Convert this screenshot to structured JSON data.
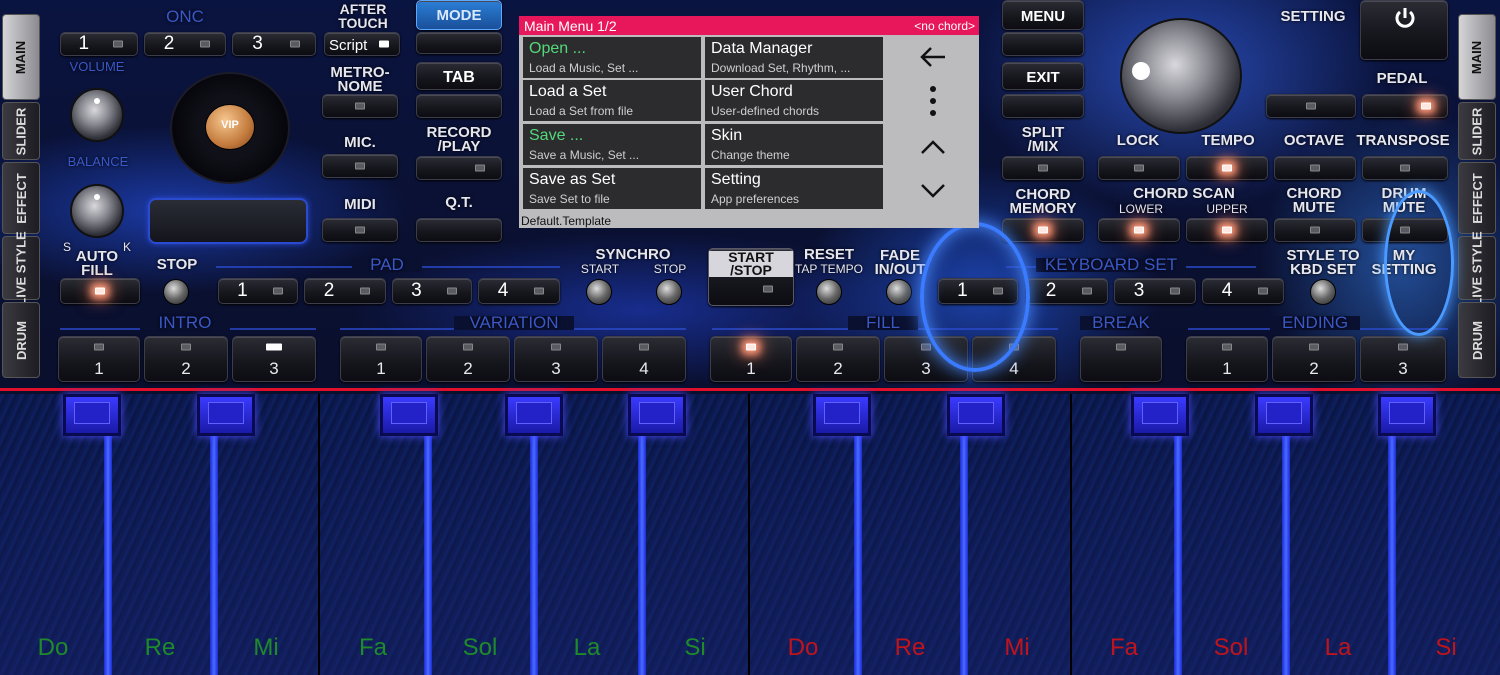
{
  "side_tabs_left": [
    "MAIN",
    "SLIDER",
    "EFFECT",
    "LIVE STYLE",
    "DRUM"
  ],
  "side_tabs_right": [
    "MAIN",
    "SLIDER",
    "EFFECT",
    "LIVE STYLE",
    "DRUM"
  ],
  "top": {
    "onc": "ONC",
    "after_touch": "AFTER TOUCH",
    "script": "Script",
    "mode": "MODE",
    "menu": "MENU",
    "setting": "SETTING",
    "onc_nums": [
      "1",
      "2",
      "3"
    ]
  },
  "left": {
    "volume": "VOLUME",
    "balance": "BALANCE",
    "metronome": "METRO-\nNOME",
    "mic": "MIC.",
    "midi": "MIDI",
    "tab": "TAB",
    "record_play": "RECORD\n/PLAY",
    "qt": "Q.T.",
    "auto_fill": "AUTO\nFILL",
    "stop": "STOP",
    "pad": "PAD",
    "pad_nums": [
      "1",
      "2",
      "3",
      "4"
    ],
    "s": "S",
    "k": "K",
    "vip": "VIP"
  },
  "center": {
    "synchro": "SYNCHRO",
    "start": "START",
    "stop": "STOP",
    "start_stop": "START\n/STOP",
    "reset": "RESET",
    "tap_tempo": "TAP TEMPO",
    "fade": "FADE\nIN/OUT",
    "exit": "EXIT",
    "split_mix": "SPLIT\n/MIX",
    "chord_memory": "CHORD\nMEMORY"
  },
  "right": {
    "pedal": "PEDAL",
    "lock": "LOCK",
    "tempo": "TEMPO",
    "octave": "OCTAVE",
    "transpose": "TRANSPOSE",
    "chord_scan": "CHORD SCAN",
    "lower": "LOWER",
    "upper": "UPPER",
    "chord_mute": "CHORD\nMUTE",
    "drum_mute": "DRUM\nMUTE",
    "keyboard_set": "KEYBOARD SET",
    "kbd_nums": [
      "1",
      "2",
      "3",
      "4"
    ],
    "style_to_kbd": "STYLE TO\nKBD SET",
    "my_setting": "MY\nSETTING"
  },
  "bottom": {
    "intro": "INTRO",
    "variation": "VARIATION",
    "fill": "FILL",
    "break": "BREAK",
    "ending": "ENDING",
    "intro_nums": [
      "1",
      "2",
      "3"
    ],
    "var_nums": [
      "1",
      "2",
      "3",
      "4"
    ],
    "fill_nums": [
      "1",
      "2",
      "3",
      "4"
    ],
    "end_nums": [
      "1",
      "2",
      "3"
    ]
  },
  "menu": {
    "title": "Main Menu  1/2",
    "chord": "<no chord>",
    "items": [
      {
        "label": "Open ...",
        "sub": "Load a Music, Set ..."
      },
      {
        "label": "Data Manager",
        "sub": "Download Set, Rhythm, ..."
      },
      {
        "label": "Load a Set",
        "sub": "Load a Set from file"
      },
      {
        "label": "User Chord",
        "sub": "User-defined chords"
      },
      {
        "label": "Save ...",
        "sub": "Save a Music, Set ..."
      },
      {
        "label": "Skin",
        "sub": "Change theme"
      },
      {
        "label": "Save as Set",
        "sub": "Save Set to file"
      },
      {
        "label": "Setting",
        "sub": "App preferences"
      }
    ],
    "footer": "Default.Template",
    "icons": [
      "back-arrow-icon",
      "more-vert-icon",
      "chevron-up-icon",
      "chevron-down-icon"
    ]
  },
  "keys": [
    "Do",
    "Re",
    "Mi",
    "Fa",
    "Sol",
    "La",
    "Si",
    "Do",
    "Re",
    "Mi",
    "Fa",
    "Sol",
    "La",
    "Si"
  ],
  "colors": {
    "menu_header": "#e8175c",
    "highlight": "#53d87a",
    "key_low": "#1f8a2a",
    "key_high": "#c0141c",
    "accent": "#2b4bcc"
  }
}
